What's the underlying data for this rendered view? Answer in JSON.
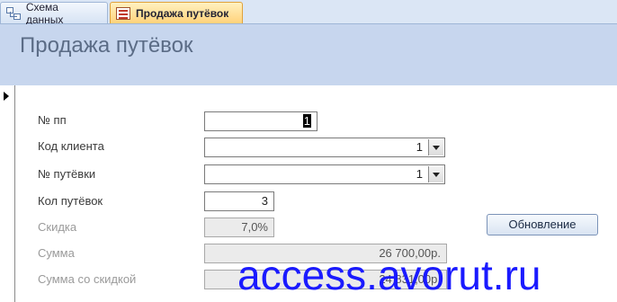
{
  "tabs": [
    {
      "label": "Схема данных",
      "icon": "relationships-icon"
    },
    {
      "label": "Продажа путёвок",
      "icon": "form-icon",
      "active": true
    }
  ],
  "form": {
    "title": "Продажа путёвок",
    "fields": {
      "num": {
        "label": "№ пп",
        "value": "1"
      },
      "client": {
        "label": "Код клиента",
        "value": "1"
      },
      "voucher": {
        "label": "№ путёвки",
        "value": "1"
      },
      "qty": {
        "label": "Кол путёвок",
        "value": "3"
      },
      "discount": {
        "label": "Скидка",
        "value": "7,0%"
      },
      "sum": {
        "label": "Сумма",
        "value": "26 700,00р."
      },
      "sum_discount": {
        "label": "Сумма со скидкой",
        "value": "24 831,00р."
      }
    },
    "refresh_button": "Обновление"
  },
  "watermark": "access.avorut.ru",
  "colors": {
    "header_bg": "#c7d6ee",
    "active_tab": "#ffd27a",
    "watermark": "#1a1aff"
  }
}
